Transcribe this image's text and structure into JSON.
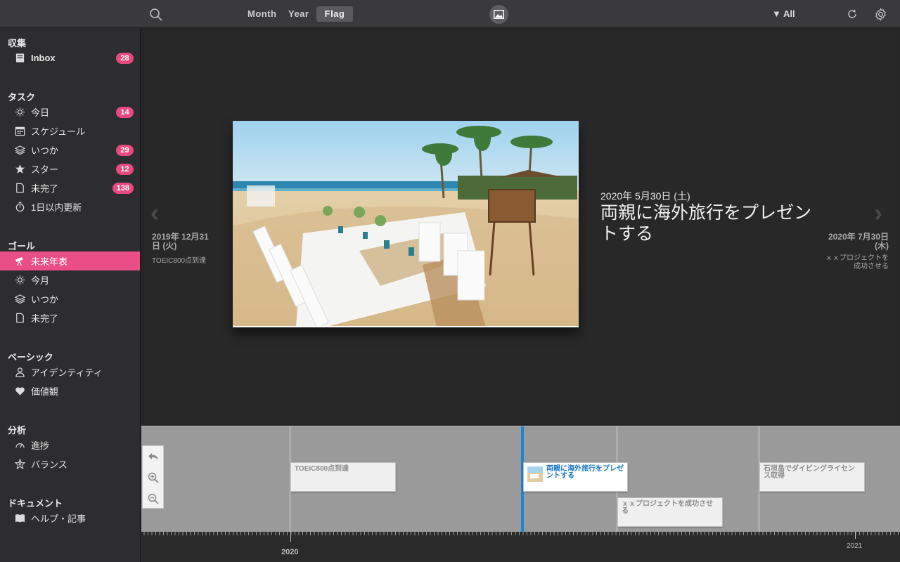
{
  "toolbar": {
    "views": [
      "Month",
      "Year",
      "Flag"
    ],
    "active_view": "Flag",
    "filter_label": "All"
  },
  "sidebar": {
    "sections": [
      {
        "title": "収集",
        "items": [
          {
            "label": "Inbox",
            "icon": "inbox-icon",
            "badge": "28",
            "bold": true
          }
        ]
      },
      {
        "title": "タスク",
        "items": [
          {
            "label": "今日",
            "icon": "sun-icon",
            "badge": "14"
          },
          {
            "label": "スケジュール",
            "icon": "calendar-icon"
          },
          {
            "label": "いつか",
            "icon": "layers-icon",
            "badge": "29"
          },
          {
            "label": "スター",
            "icon": "star-icon",
            "badge": "12"
          },
          {
            "label": "未完了",
            "icon": "document-icon",
            "badge": "138"
          },
          {
            "label": "1日以内更新",
            "icon": "stopwatch-icon"
          }
        ]
      },
      {
        "title": "ゴール",
        "items": [
          {
            "label": "未来年表",
            "icon": "telescope-icon",
            "selected": true
          },
          {
            "label": "今月",
            "icon": "sun-icon"
          },
          {
            "label": "いつか",
            "icon": "layers-icon"
          },
          {
            "label": "未完了",
            "icon": "document-icon"
          }
        ]
      },
      {
        "title": "ベーシック",
        "items": [
          {
            "label": "アイデンティティ",
            "icon": "person-icon"
          },
          {
            "label": "価値観",
            "icon": "heart-icon"
          }
        ]
      },
      {
        "title": "分析",
        "items": [
          {
            "label": "進捗",
            "icon": "gauge-icon"
          },
          {
            "label": "バランス",
            "icon": "radar-icon"
          }
        ]
      },
      {
        "title": "ドキュメント",
        "items": [
          {
            "label": "ヘルプ・記事",
            "icon": "book-icon"
          }
        ]
      }
    ]
  },
  "main": {
    "current": {
      "date": "2020年 5月30日 (土)",
      "title": "両親に海外旅行をプレゼントする"
    },
    "previous": {
      "date": "2019年 12月31日 (火)",
      "title": "TOEIC800点到達"
    },
    "next": {
      "date": "2020年 7月30日 (木)",
      "title": "ｘｘプロジェクトを成功させる"
    }
  },
  "timeline": {
    "cards": [
      {
        "label": "TOEIC800点到達",
        "active": false
      },
      {
        "label": "両親に海外旅行をプレゼントする",
        "active": true
      },
      {
        "label": "ｘｘプロジェクトを成功させる",
        "active": false
      },
      {
        "label": "石垣島でダイビングライセンス取得",
        "active": false
      }
    ],
    "years": [
      "2020",
      "2021"
    ]
  },
  "colors": {
    "accent": "#e94f86",
    "timeline_current": "#1a86d8"
  }
}
